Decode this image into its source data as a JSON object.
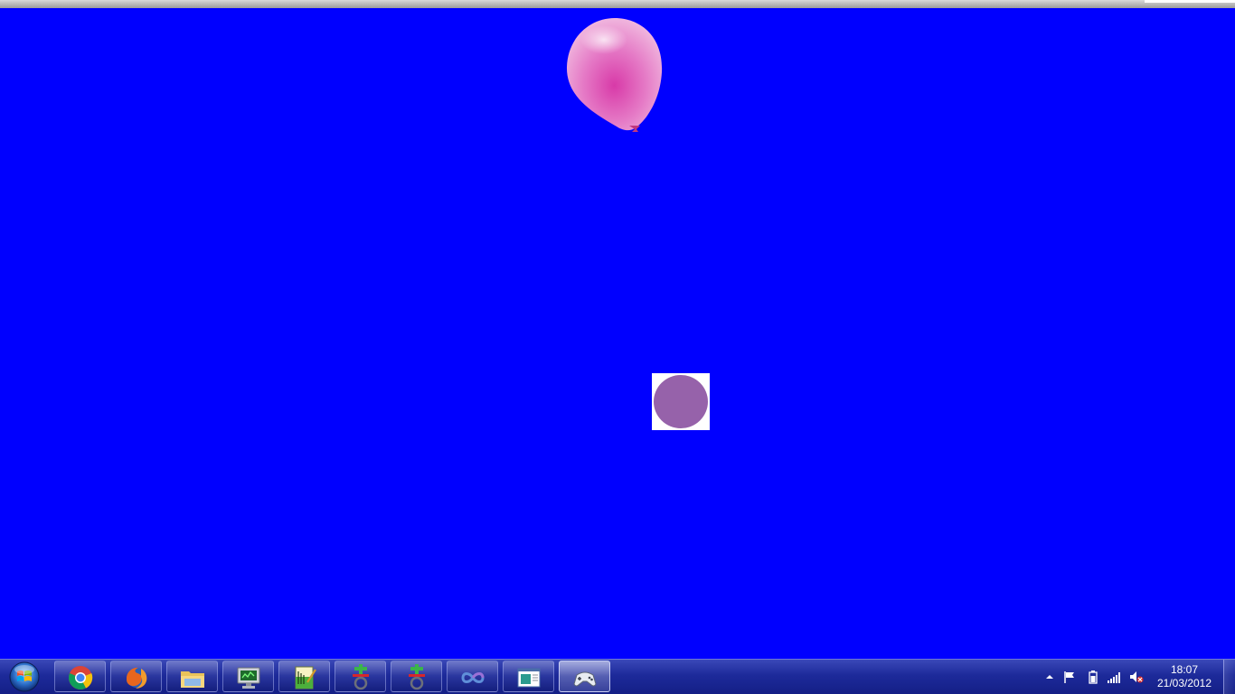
{
  "colors": {
    "game_background": "#0000ff",
    "balloon": "#e070c0",
    "target_disc": "#9662aa",
    "target_tile": "#ffffff",
    "taskbar": "#1d2a9a"
  },
  "game": {
    "balloon_icon": "pink-balloon",
    "target_icon": "purple-circle"
  },
  "taskbar": {
    "start_icon": "windows-orb",
    "apps": [
      {
        "name": "chrome",
        "icon": "chrome-icon",
        "active": false
      },
      {
        "name": "firefox",
        "icon": "firefox-icon",
        "active": false
      },
      {
        "name": "explorer",
        "icon": "folder-icon",
        "active": false
      },
      {
        "name": "monitor",
        "icon": "computer-icon",
        "active": false
      },
      {
        "name": "editor",
        "icon": "notepad-icon",
        "active": false
      },
      {
        "name": "app-1",
        "icon": "plus-button-icon",
        "active": false
      },
      {
        "name": "app-2",
        "icon": "plus-button-icon",
        "active": false
      },
      {
        "name": "infinity",
        "icon": "infinity-icon",
        "active": false
      },
      {
        "name": "window",
        "icon": "window-icon",
        "active": false
      },
      {
        "name": "game",
        "icon": "gamepad-icon",
        "active": true
      }
    ],
    "tray_icons": [
      "show-hidden-icon",
      "flag-icon",
      "battery-icon",
      "signal-icon",
      "volume-muted-icon"
    ],
    "clock": {
      "time": "18:07",
      "date": "21/03/2012"
    }
  }
}
